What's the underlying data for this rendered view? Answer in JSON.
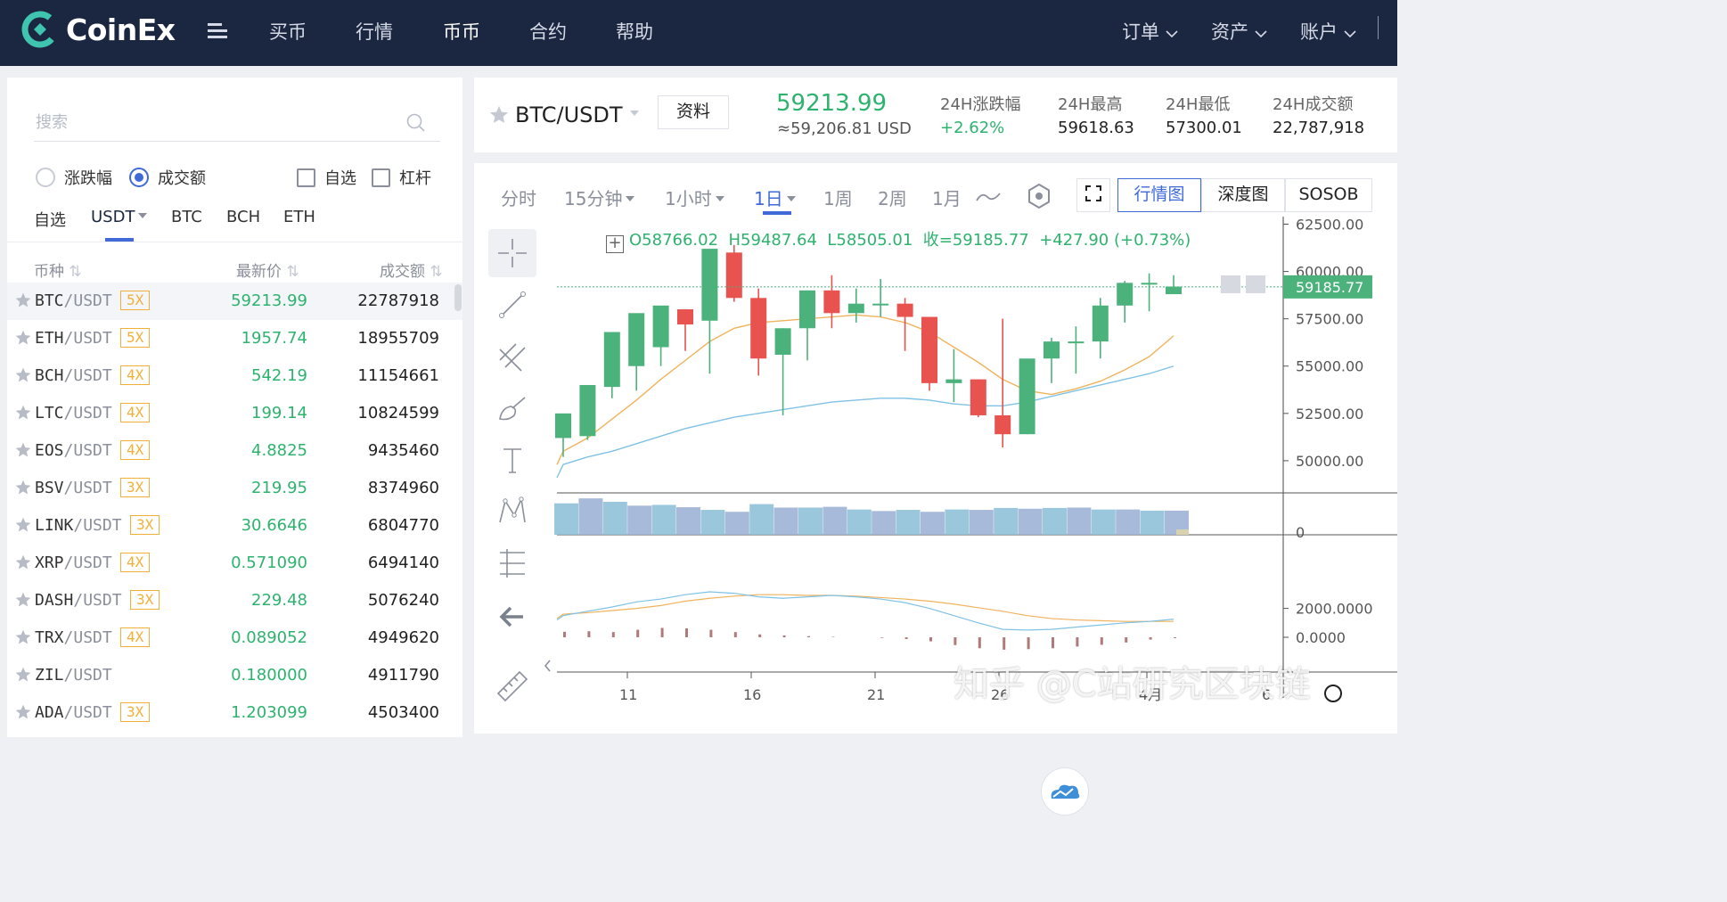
{
  "nav": {
    "brand": "CoinEx",
    "items": [
      "买币",
      "行情",
      "币币",
      "合约",
      "帮助"
    ],
    "active_index": 2,
    "right": [
      "订单",
      "资产",
      "账户"
    ]
  },
  "market": {
    "search_placeholder": "搜索",
    "sort_options": [
      "涨跌幅",
      "成交额"
    ],
    "sort_selected": 1,
    "filters": [
      "自选",
      "杠杆"
    ],
    "tabs": [
      "自选",
      "USDT",
      "BTC",
      "BCH",
      "ETH"
    ],
    "active_tab": 1,
    "columns": [
      "币种",
      "最新价",
      "成交额"
    ],
    "rows": [
      {
        "base": "BTC",
        "quote": "/USDT",
        "lev": "5X",
        "price": "59213.99",
        "vol": "22787918"
      },
      {
        "base": "ETH",
        "quote": "/USDT",
        "lev": "5X",
        "price": "1957.74",
        "vol": "18955709"
      },
      {
        "base": "BCH",
        "quote": "/USDT",
        "lev": "4X",
        "price": "542.19",
        "vol": "11154661"
      },
      {
        "base": "LTC",
        "quote": "/USDT",
        "lev": "4X",
        "price": "199.14",
        "vol": "10824599"
      },
      {
        "base": "EOS",
        "quote": "/USDT",
        "lev": "4X",
        "price": "4.8825",
        "vol": "9435460"
      },
      {
        "base": "BSV",
        "quote": "/USDT",
        "lev": "3X",
        "price": "219.95",
        "vol": "8374960"
      },
      {
        "base": "LINK",
        "quote": "/USDT",
        "lev": "3X",
        "price": "30.6646",
        "vol": "6804770"
      },
      {
        "base": "XRP",
        "quote": "/USDT",
        "lev": "4X",
        "price": "0.571090",
        "vol": "6494140"
      },
      {
        "base": "DASH",
        "quote": "/USDT",
        "lev": "3X",
        "price": "229.48",
        "vol": "5076240"
      },
      {
        "base": "TRX",
        "quote": "/USDT",
        "lev": "4X",
        "price": "0.089052",
        "vol": "4949620"
      },
      {
        "base": "ZIL",
        "quote": "/USDT",
        "lev": "",
        "price": "0.180000",
        "vol": "4911790"
      },
      {
        "base": "ADA",
        "quote": "/USDT",
        "lev": "3X",
        "price": "1.203099",
        "vol": "4503400"
      }
    ]
  },
  "ticker": {
    "pair": "BTC/USDT",
    "info_button": "资料",
    "price": "59213.99",
    "usd": "≈59,206.81 USD",
    "stats": [
      {
        "label": "24H涨跌幅",
        "value": "+2.62%",
        "positive": true
      },
      {
        "label": "24H最高",
        "value": "59618.63"
      },
      {
        "label": "24H最低",
        "value": "57300.01"
      },
      {
        "label": "24H成交额",
        "value": "22,787,918"
      }
    ]
  },
  "chart_toolbar": {
    "intervals": [
      "分时",
      "15分钟",
      "1小时",
      "1日",
      "1周",
      "2周",
      "1月"
    ],
    "active_interval": 3,
    "views": [
      "行情图",
      "深度图",
      "SOSOB"
    ],
    "active_view": 0
  },
  "ohlc": {
    "o": "O58766.02",
    "h": "H59487.64",
    "l": "L58505.01",
    "c": "收=59185.77",
    "chg": "+427.90 (+0.73%)"
  },
  "chart_data": {
    "type": "candlestick",
    "x_ticks": [
      "11",
      "16",
      "21",
      "26",
      "4月",
      "6"
    ],
    "y_ticks": [
      "62500.00",
      "60000.00",
      "57500.00",
      "55000.00",
      "52500.00",
      "50000.00"
    ],
    "ylim": [
      48300,
      62900
    ],
    "last_price_label": "59185.77",
    "volume_axis_label": "0",
    "macd_ticks": [
      "2000.0000",
      "0.0000"
    ],
    "candles": [
      [
        51200,
        52500,
        50200,
        51600
      ],
      [
        51300,
        54000,
        51100,
        53900
      ],
      [
        53900,
        56800,
        53300,
        55000
      ],
      [
        55000,
        57800,
        53700,
        56000
      ],
      [
        56000,
        58200,
        55000,
        58000
      ],
      [
        58000,
        57200,
        55800,
        57400
      ],
      [
        57400,
        61200,
        54600,
        61000
      ],
      [
        61000,
        58600,
        58400,
        61400
      ],
      [
        58600,
        55400,
        54500,
        59100
      ],
      [
        55600,
        57000,
        52400,
        57000
      ],
      [
        57000,
        59000,
        55300,
        59000
      ],
      [
        59000,
        57800,
        57000,
        59800
      ],
      [
        57800,
        58300,
        57300,
        59100
      ],
      [
        58300,
        58300,
        57600,
        59600
      ],
      [
        58300,
        57600,
        55800,
        58600
      ],
      [
        57600,
        54100,
        53700,
        57600
      ],
      [
        54100,
        54300,
        53100,
        55900
      ],
      [
        54300,
        52400,
        52300,
        54300
      ],
      [
        52400,
        51400,
        50700,
        57500
      ],
      [
        51400,
        55400,
        51400,
        52600
      ],
      [
        55400,
        56300,
        54100,
        56500
      ],
      [
        56300,
        56300,
        54600,
        57100
      ],
      [
        56300,
        58200,
        55400,
        58600
      ],
      [
        58200,
        59400,
        57300,
        59500
      ],
      [
        59400,
        59400,
        57900,
        59900
      ],
      [
        58800,
        59200,
        58800,
        59800
      ]
    ],
    "ma_fast": [
      50500,
      51200,
      52200,
      53200,
      54300,
      55300,
      56300,
      57000,
      57300,
      57400,
      57500,
      57600,
      57700,
      57600,
      57300,
      56800,
      56000,
      55200,
      54300,
      53700,
      53500,
      53800,
      54200,
      54800,
      55500,
      56600
    ],
    "ma_slow": [
      49800,
      50200,
      50500,
      50900,
      51300,
      51700,
      52000,
      52300,
      52500,
      52700,
      52900,
      53100,
      53200,
      53300,
      53300,
      53200,
      53000,
      52900,
      52900,
      53100,
      53400,
      53700,
      54000,
      54300,
      54600,
      55000
    ],
    "volumes": [
      0.82,
      0.95,
      0.86,
      0.76,
      0.78,
      0.72,
      0.65,
      0.6,
      0.8,
      0.71,
      0.71,
      0.73,
      0.66,
      0.62,
      0.65,
      0.6,
      0.66,
      0.65,
      0.7,
      0.68,
      0.7,
      0.71,
      0.66,
      0.66,
      0.63,
      0.63
    ],
    "dif": [
      1500,
      1800,
      2100,
      2450,
      2650,
      2950,
      3150,
      3050,
      2800,
      2700,
      2800,
      2900,
      2800,
      2650,
      2400,
      2000,
      1500,
      1000,
      550,
      500,
      550,
      700,
      850,
      1000,
      1100,
      1250
    ],
    "dea": [
      1600,
      1700,
      1850,
      2000,
      2200,
      2500,
      2700,
      2850,
      2950,
      2950,
      2900,
      2900,
      2850,
      2750,
      2650,
      2500,
      2300,
      2050,
      1800,
      1500,
      1300,
      1200,
      1150,
      1100,
      1100,
      1100
    ],
    "hist": [
      380,
      420,
      360,
      520,
      650,
      620,
      520,
      360,
      200,
      130,
      80,
      30,
      0,
      -40,
      -120,
      -280,
      -540,
      -760,
      -860,
      -820,
      -760,
      -640,
      -520,
      -360,
      -160,
      -60
    ]
  },
  "watermark": "知乎 @C站研究区块链",
  "colors": {
    "up": "#4cb27c",
    "down": "#e8524f",
    "accent": "#3f6ad8",
    "nav_bg": "#1b2640",
    "ma_fast": "#f0b35c",
    "ma_slow": "#7fc2e6"
  }
}
